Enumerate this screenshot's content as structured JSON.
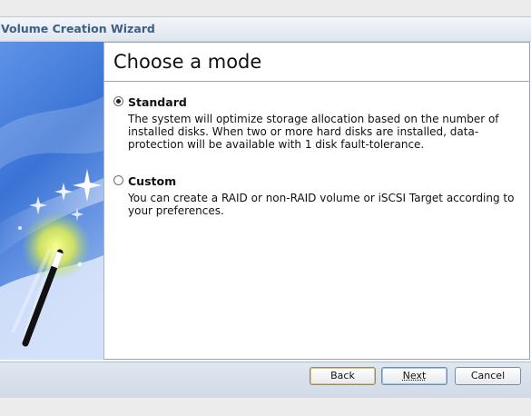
{
  "window": {
    "title": "Volume Creation Wizard"
  },
  "page": {
    "heading": "Choose a mode"
  },
  "options": [
    {
      "label": "Standard",
      "selected": true,
      "description": "The system will optimize storage allocation based on the number of installed disks. When two or more hard disks are installed, data-protection will be available with 1 disk fault-tolerance."
    },
    {
      "label": "Custom",
      "selected": false,
      "description": "You can create a RAID or non-RAID volume or iSCSI Target according to your preferences."
    }
  ],
  "buttons": {
    "back": "Back",
    "next": "Next",
    "cancel": "Cancel"
  },
  "icons": {
    "side_panel": "magic-wand-icon"
  },
  "colors": {
    "title_text": "#3d5f87",
    "panel_blue": "#3a73d6",
    "accent_yellow": "#f2f05a"
  }
}
